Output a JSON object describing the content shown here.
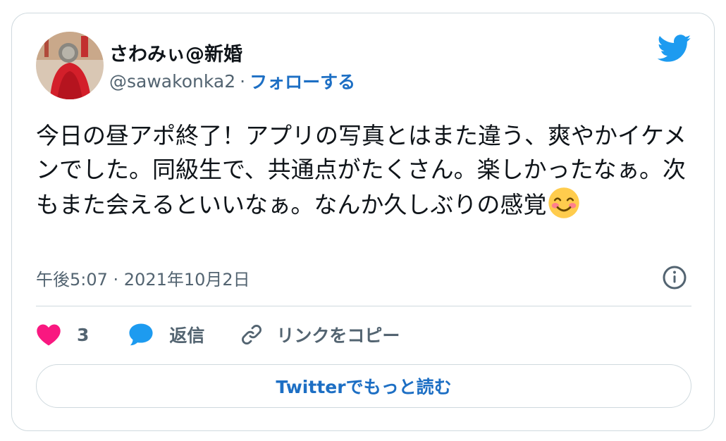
{
  "user": {
    "display_name": "さわみぃ@新婚",
    "handle": "@sawakonka2",
    "separator": "·",
    "follow_label": "フォローする"
  },
  "tweet": {
    "text": "今日の昼アポ終了！アプリの写真とはまた違う、爽やかイケメンでした。同級生で、共通点がたくさん。楽しかったなぁ。次もまた会えるといいなぁ。なんか久しぶりの感覚",
    "emoji_name": "smiling-face-with-smiling-eyes",
    "timestamp": "午後5:07 · 2021年10月2日"
  },
  "actions": {
    "like_count": "3",
    "reply_label": "返信",
    "copy_link_label": "リンクをコピー"
  },
  "read_more_label": "Twitterでもっと読む",
  "icons": {
    "brand": "twitter-bird-icon",
    "info": "info-icon",
    "like": "heart-icon",
    "reply": "speech-bubble-icon",
    "link": "link-icon"
  },
  "colors": {
    "twitter_blue": "#1d9bf0",
    "link_blue": "#1d6fc4",
    "like_pink": "#f91880",
    "secondary_text": "#536471",
    "border": "#cfd9de"
  }
}
